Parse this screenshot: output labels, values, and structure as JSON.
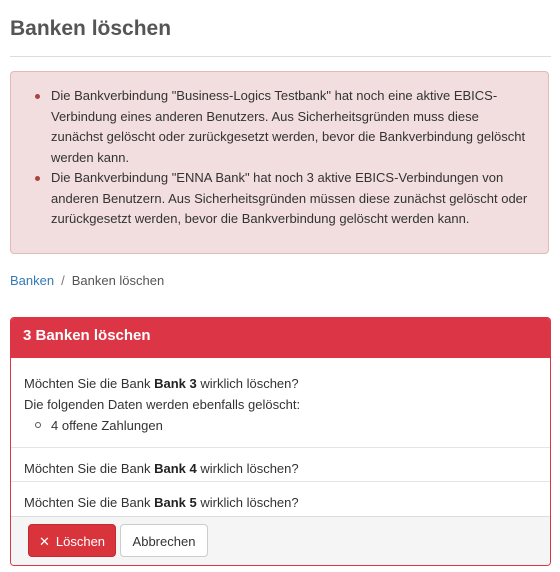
{
  "page": {
    "title": "Banken löschen"
  },
  "alert": {
    "color": "#f2dede",
    "messages": [
      "Die Bankverbindung \"Business-Logics Testbank\" hat noch eine aktive EBICS-Verbindung eines anderen Benutzers. Aus Sicherheitsgründen muss diese zunächst gelöscht oder zurückgesetzt werden, bevor die Bankverbindung gelöscht werden kann.",
      "Die Bankverbindung \"ENNA Bank\" hat noch 3 aktive EBICS-Verbindungen von anderen Benutzern. Aus Sicherheitsgründen müssen diese zunächst gelöscht oder zurückgesetzt werden, bevor die Bankverbindung gelöscht werden kann."
    ]
  },
  "breadcrumb": {
    "items": [
      "Banken",
      "Banken löschen"
    ],
    "separator": "/"
  },
  "panel": {
    "header": "3 Banken löschen",
    "accent": "#dc3545",
    "question_prefix": "Möchten Sie die Bank",
    "question_suffix": "wirklich löschen?",
    "banks": [
      {
        "name": "Bank 3",
        "extra_label": "Die folgenden Daten werden ebenfalls gelöscht:",
        "extra_items": [
          "4 offene Zahlungen"
        ]
      },
      {
        "name": "Bank 4"
      },
      {
        "name": "Bank 5"
      }
    ]
  },
  "actions": {
    "delete_label": "Löschen",
    "delete_icon": "x-icon",
    "cancel_label": "Abbrechen"
  }
}
